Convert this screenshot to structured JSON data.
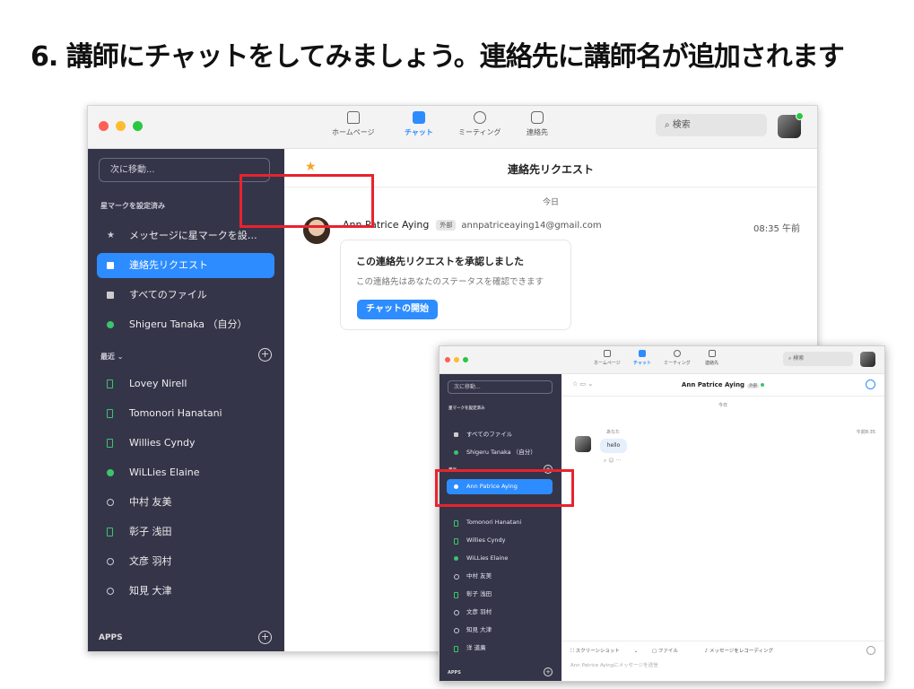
{
  "slide": {
    "title": "6. 講師にチャットをしてみましょう。連絡先に講師名が追加されます"
  },
  "main": {
    "nav": [
      {
        "label": "ホームページ",
        "icon": "home-icon"
      },
      {
        "label": "チャット",
        "icon": "chat-icon"
      },
      {
        "label": "ミーティング",
        "icon": "clock-icon"
      },
      {
        "label": "連絡先",
        "icon": "contacts-icon"
      }
    ],
    "search_placeholder": "検索",
    "jump": "次に移動...",
    "starred_heading": "星マークを設定済み",
    "starred_items": [
      "メッセージに星マークを設…",
      "連絡先リクエスト",
      "すべてのファイル",
      "Shigeru Tanaka （自分）"
    ],
    "recent_heading": "最近",
    "recent_items": [
      "Lovey Nirell",
      "Tomonori Hanatani",
      "Willies Cyndy",
      "WiLLies Elaine",
      "中村 友美",
      "彰子 浅田",
      "文彦 羽村",
      "知見 大津"
    ],
    "apps": "APPS",
    "content_title": "連絡先リクエスト",
    "today": "今日",
    "sender": "Ann Patrice Aying",
    "external_tag": "外部",
    "email": "annpatriceaying14@gmail.com",
    "time": "08:35 午前",
    "card_title": "この連絡先リクエストを承認しました",
    "card_sub": "この連絡先はあなたのステータスを確認できます",
    "card_button": "チャットの開始"
  },
  "inset": {
    "nav": [
      "ホームページ",
      "チャット",
      "ミーティング",
      "連絡先"
    ],
    "search_placeholder": "検索",
    "jump": "次に移動...",
    "starred_heading": "星マークを設定済み",
    "items": [
      "すべてのファイル",
      "Shigeru Tanaka （自分）"
    ],
    "recent_heading": "最近",
    "active_contact": "Ann Patrice Aying",
    "recent_items": [
      "Tomonori Hanatani",
      "Willies Cyndy",
      "WiLLies Elaine",
      "中村 友美",
      "彰子 浅田",
      "文彦 羽村",
      "知見 大津",
      "洋 道廣"
    ],
    "apps": "APPS",
    "chat_title": "Ann Patrice Aying",
    "external_tag": "外部",
    "today": "今日",
    "you_label": "あなた",
    "time": "午前8:35",
    "message": "hello",
    "toolbar": [
      "スクリーンショット",
      "ファイル",
      "メッセージをレコーディング"
    ],
    "input_placeholder": "Ann Patrice Ayingにメッセージを送信"
  },
  "colors": {
    "accent": "#2d8cff",
    "sidebar": "#35354a",
    "highlight": "#e8232e",
    "online": "#3cc46a"
  }
}
